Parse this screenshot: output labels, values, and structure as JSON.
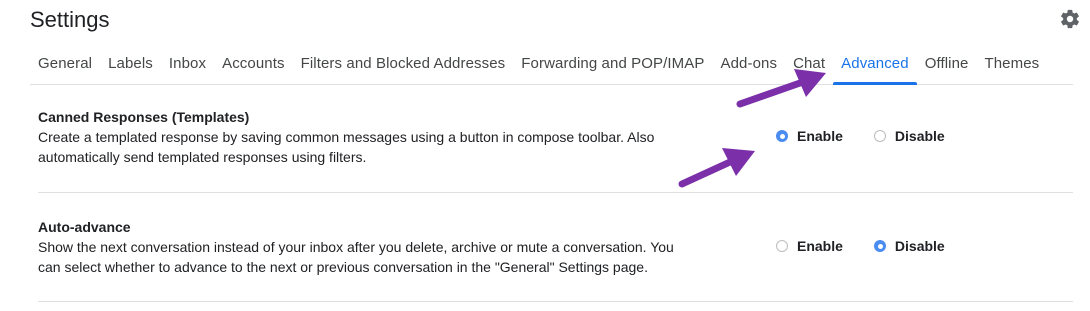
{
  "header": {
    "title": "Settings",
    "settings_icon": "gear-icon"
  },
  "tabs": [
    {
      "label": "General",
      "active": false
    },
    {
      "label": "Labels",
      "active": false
    },
    {
      "label": "Inbox",
      "active": false
    },
    {
      "label": "Accounts",
      "active": false
    },
    {
      "label": "Filters and Blocked Addresses",
      "active": false
    },
    {
      "label": "Forwarding and POP/IMAP",
      "active": false
    },
    {
      "label": "Add-ons",
      "active": false
    },
    {
      "label": "Chat",
      "active": false
    },
    {
      "label": "Advanced",
      "active": true
    },
    {
      "label": "Offline",
      "active": false
    },
    {
      "label": "Themes",
      "active": false
    }
  ],
  "sections": [
    {
      "title": "Canned Responses (Templates)",
      "description": "Create a templated response by saving common messages using a button in compose toolbar. Also automatically send templated responses using filters.",
      "enable_label": "Enable",
      "disable_label": "Disable",
      "selected": "Enable"
    },
    {
      "title": "Auto-advance",
      "description": "Show the next conversation instead of your inbox after you delete, archive or mute a conversation. You can select whether to advance to the next or previous conversation in the \"General\" Settings page.",
      "enable_label": "Enable",
      "disable_label": "Disable",
      "selected": "Disable"
    }
  ],
  "colors": {
    "accent": "#1a73e8",
    "radio_checked": "#4a8cf0",
    "annotation_arrow": "#7b2fa8"
  }
}
